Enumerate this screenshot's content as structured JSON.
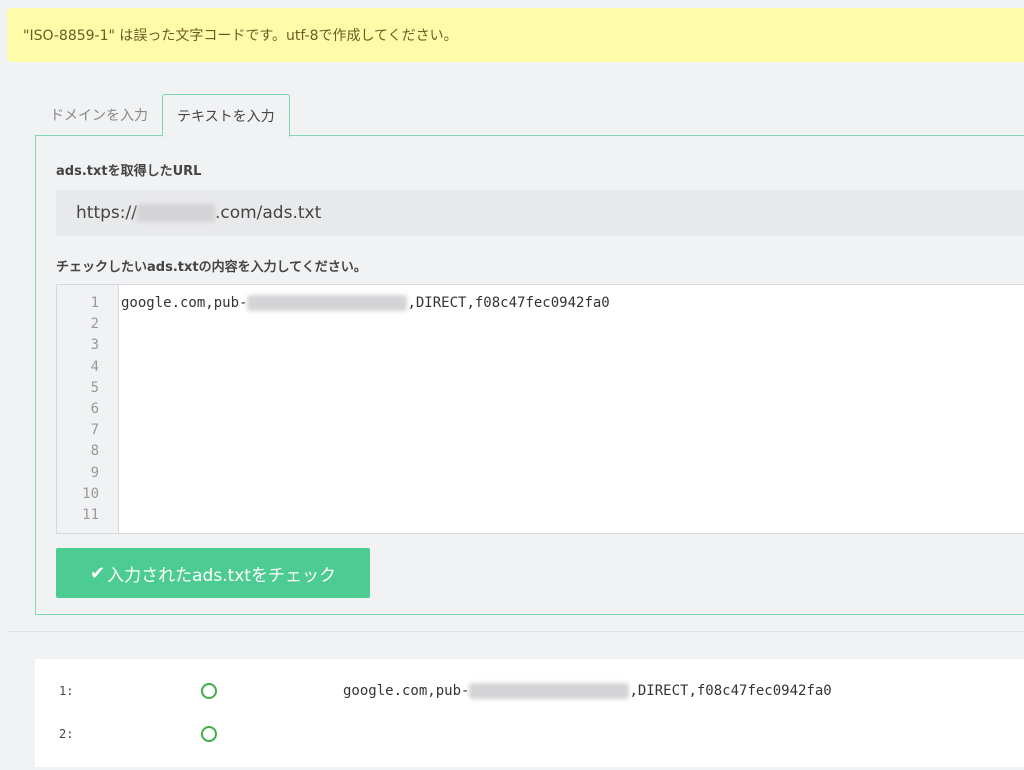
{
  "alert": {
    "message": "\"ISO-8859-1\" は誤った文字コードです。utf-8で作成してください。"
  },
  "tabs": [
    {
      "label": "ドメインを入力",
      "active": false
    },
    {
      "label": "テキストを入力",
      "active": true
    }
  ],
  "form": {
    "url_label": "ads.txtを取得したURL",
    "url_prefix": "https://",
    "url_suffix": ".com/ads.txt",
    "content_label": "チェックしたいads.txtの内容を入力してください。",
    "line_numbers": [
      "1",
      "2",
      "3",
      "4",
      "5",
      "6",
      "7",
      "8",
      "9",
      "10",
      "11"
    ],
    "code_prefix": "google.com,pub-",
    "code_suffix": ",DIRECT,f08c47fec0942fa0",
    "submit_label": "入力されたads.txtをチェック"
  },
  "results": [
    {
      "num": "1:",
      "status": "ok",
      "prefix": "google.com,pub-",
      "suffix": ",DIRECT,f08c47fec0942fa0"
    },
    {
      "num": "2:",
      "status": "ok",
      "prefix": "",
      "suffix": ""
    }
  ],
  "colors": {
    "accent": "#4ccc93",
    "ok": "#3fae45",
    "alert_bg": "#fefca8",
    "tab_border": "#7fd6b4"
  },
  "icons": {
    "submit": "check-icon",
    "status": "circle-ok-icon"
  }
}
